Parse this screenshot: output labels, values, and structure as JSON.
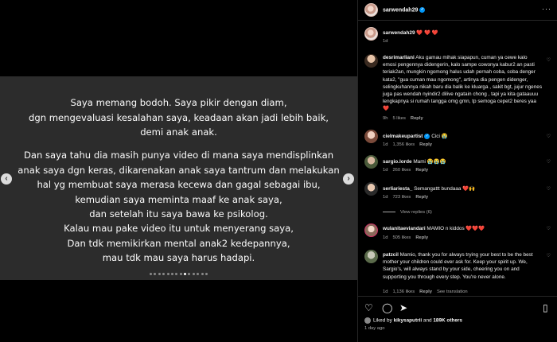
{
  "post": {
    "paragraph1": [
      "Saya memang bodoh. Saya pikir dengan diam,",
      "dgn mengevaluasi kesalahan saya, keadaan akan jadi lebih baik,",
      "demi anak anak."
    ],
    "paragraph2": [
      "Dan saya tahu dia masih punya video di mana saya mendisplinkan",
      "anak saya dgn keras, dikarenakan anak saya tantrum dan melakukan",
      "hal yg membuat saya merasa kecewa dan gagal sebagai ibu,",
      "kemudian saya meminta maaf ke anak saya,",
      "dan setelah itu saya bawa ke psikolog."
    ],
    "paragraph3": [
      "Kalau mau pake video itu untuk menyerang saya,",
      "Dan tdk memikirkan mental anak2 kedepannya,",
      "mau tdk mau saya harus hadapi."
    ],
    "prev_icon": "chevron-left-icon",
    "next_icon": "chevron-right-icon",
    "slide_count": 14,
    "active_slide": 9
  },
  "header": {
    "username": "sarwendah29",
    "verified_icon": "verified-badge-icon",
    "more_icon": "more-horizontal-icon"
  },
  "caption": {
    "username": "sarwendah29",
    "text": "❤️ ❤️ ❤️",
    "time": "1d"
  },
  "comments": [
    {
      "username": "desrimarliani",
      "text": "Aku gamau mihak siapapun, cuman ya cewe kalo emosi pengennya didengerin, kalo sampe cowonya kabur2 an pasti teriak2an, mungkin ngomong halus udah pernah coba, coba denger kata2, \"gua cuman mau ngomong\", artinya dia pengen didenger, selingkuhannya nikah baru dia balik ke kluarga , sakit bgt, jujur ngenes juga pas wendah nyindir2 dilive ngatain chong , tapi ya kita gataauuu lengkapnya si rumah tangga omg gmn, tp semoga cepet2 beres yaa ❤️",
      "time": "9h",
      "likes": "5 likes",
      "reply": "Reply"
    },
    {
      "username": "cielmakeupartist",
      "text": "Cici 😭",
      "time": "1d",
      "likes": "1,356 likes",
      "reply": "Reply"
    },
    {
      "username": "sargio.lorde",
      "text": "Mami 😭😭😭",
      "time": "1d",
      "likes": "260 likes",
      "reply": "Reply"
    },
    {
      "username": "serliariesta_",
      "text": "Semangattt bundaaa ❤️🙌",
      "time": "1d",
      "likes": "723 likes",
      "reply": "Reply",
      "view_replies": "View replies (6)"
    },
    {
      "username": "wulanitaeviandari",
      "text": "MAMIO n kiddos ❤️❤️❤️",
      "time": "1d",
      "likes": "505 likes",
      "reply": "Reply"
    },
    {
      "username": "patzcil",
      "text": "Mamio, thank you for always trying your best to be the best mother your children could ever ask for. Keep your spirit up. We, Sargio's, will always stand by your side, cheering you on and supporting you through every step. You're never alone.",
      "time": "1d",
      "likes": "1,136 likes",
      "reply": "Reply",
      "translation": "See translation"
    }
  ],
  "actions": {
    "like_icon": "heart-icon",
    "comment_icon": "comment-icon",
    "share_icon": "share-icon",
    "save_icon": "bookmark-icon"
  },
  "likes_summary": {
    "prefix": "Liked by",
    "user": "kikysaputrii",
    "joiner": "and",
    "others": "189K others"
  },
  "posted_ago": "1 day ago",
  "colors": {
    "background": "#000000",
    "slide_background": "#2c2c2c",
    "verified": "#0095f6",
    "heart": "#e0245e",
    "muted_text": "#a8a8a8"
  }
}
